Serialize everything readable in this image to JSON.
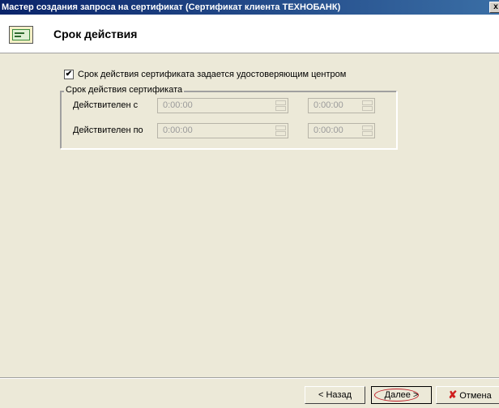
{
  "window": {
    "title": "Мастер создания запроса на сертификат (Сертификат клиента ТЕХНОБАНК)",
    "close_glyph": "x"
  },
  "header": {
    "title": "Срок действия",
    "icon": "certificate-icon"
  },
  "checkbox": {
    "label": "Срок действия сертификата задается удостоверяющим центром",
    "checked": true,
    "mark": "✔"
  },
  "group": {
    "title": "Срок действия сертификата",
    "rows": [
      {
        "label": "Действителен с",
        "date_value": "0:00:00",
        "time_value": "0:00:00"
      },
      {
        "label": "Действителен по",
        "date_value": "0:00:00",
        "time_value": "0:00:00"
      }
    ]
  },
  "footer": {
    "back_label": "< Назад",
    "next_label": "Далее >",
    "cancel_label": "Отмена",
    "cancel_icon": "cancel-x-icon"
  },
  "colors": {
    "title_bar_start": "#0a246a",
    "title_bar_end": "#3a6ea5",
    "face": "#ece9d8",
    "annotation_ring": "#c0202a",
    "cancel_icon": "#d02020"
  }
}
